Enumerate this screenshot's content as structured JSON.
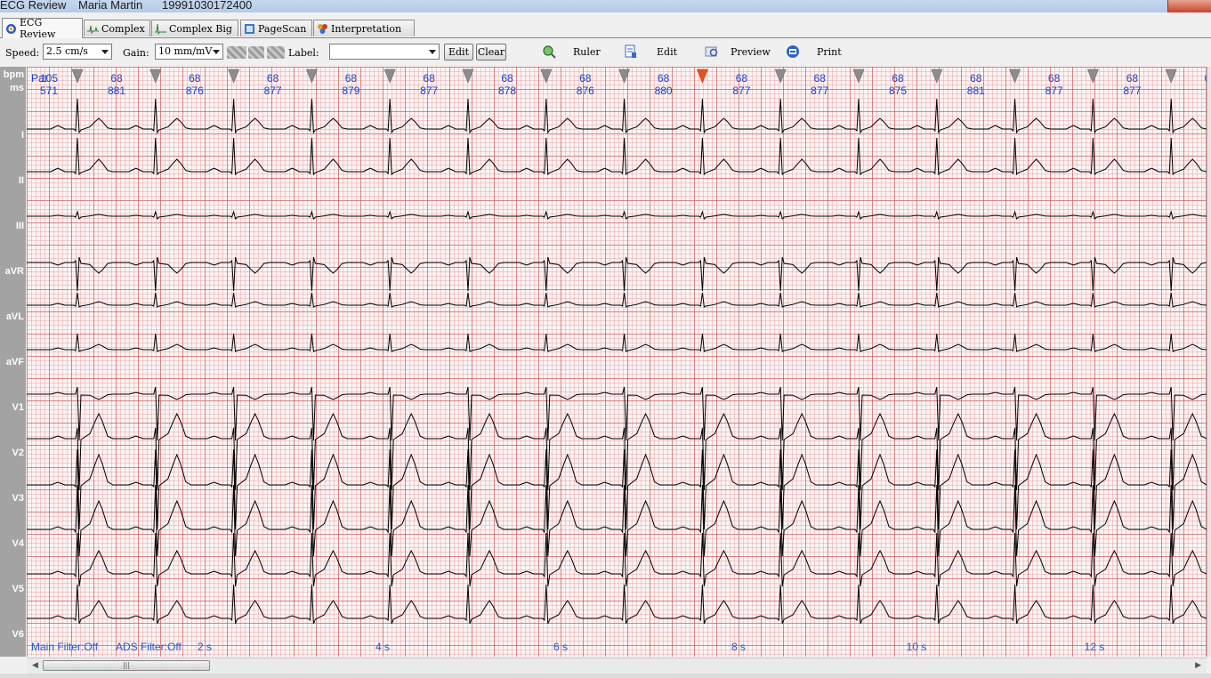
{
  "window": {
    "title": "ECG Review",
    "patient_name": "Maria  Martin",
    "record_id": "19991030172400"
  },
  "tabs": [
    {
      "label": "ECG Review",
      "icon": "ecg-review-icon",
      "active": true
    },
    {
      "label": "Complex",
      "icon": "complex-waveform-icon",
      "active": false
    },
    {
      "label": "Complex Big",
      "icon": "complex-big-waveform-icon",
      "active": false
    },
    {
      "label": "PageScan",
      "icon": "pagescan-icon",
      "active": false
    },
    {
      "label": "Interpretation",
      "icon": "interpretation-icon",
      "active": false
    }
  ],
  "toolbar": {
    "speed_label": "Speed:",
    "speed_value": "2.5  cm/s",
    "gain_label": "Gain:",
    "gain_value": "10 mm/mV",
    "label_label": "Label:",
    "label_value": "",
    "edit_label": "Edit",
    "clear_label": "Clear",
    "ruler_label": "Ruler",
    "edit_tool_label": "Edit",
    "preview_label": "Preview",
    "print_label": "Print"
  },
  "axis_labels": {
    "bpm": "bpm",
    "ms": "ms"
  },
  "leads": [
    "I",
    "II",
    "III",
    "aVR",
    "aVL",
    "aVF",
    "V1",
    "V2",
    "V3",
    "V4",
    "V5",
    "V6"
  ],
  "pat_label": "Pat",
  "beats": {
    "bpm": [
      "105",
      "68",
      "68",
      "68",
      "68",
      "68",
      "68",
      "68",
      "68",
      "68",
      "68",
      "68",
      "68",
      "68",
      "68",
      "68",
      "6"
    ],
    "ms": [
      "571",
      "881",
      "876",
      "877",
      "879",
      "877",
      "878",
      "876",
      "880",
      "877",
      "877",
      "875",
      "881",
      "877",
      "877"
    ],
    "selected_beat": 8
  },
  "footer": {
    "main_filter": "Main Filter:Off",
    "ads_filter": "ADS Filter:Off",
    "time_labels": [
      "2 s",
      "4 s",
      "6 s",
      "8 s",
      "10 s",
      "12 s"
    ]
  },
  "colors": {
    "grid_major": "#c44c4c",
    "grid_minor": "#e29c9c",
    "trace": "#000000",
    "annotation_text": "#1f3fd0",
    "footer_text": "#2b58c8",
    "beat_marker": "#8c8c8c",
    "selected_marker": "#e8501c"
  }
}
